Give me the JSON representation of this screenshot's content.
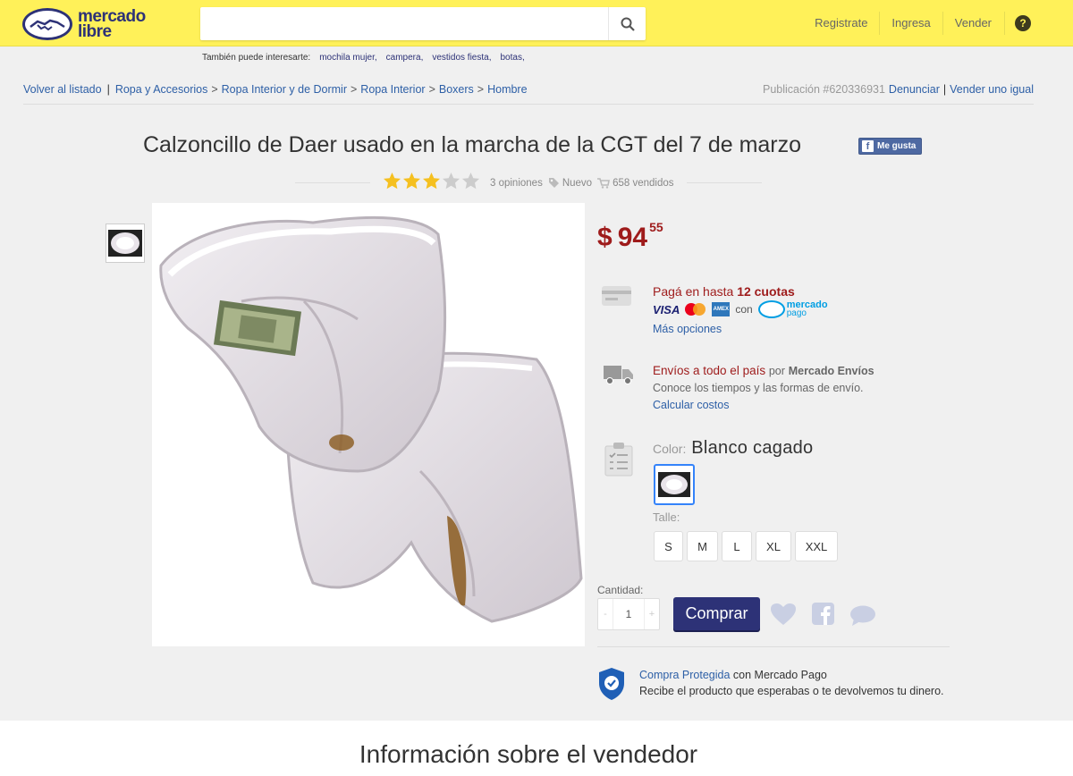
{
  "header": {
    "logo_line1": "mercado",
    "logo_line2": "libre",
    "search_placeholder": "",
    "nav": [
      "Registrate",
      "Ingresa",
      "Vender"
    ],
    "help": "?"
  },
  "suggestions": {
    "label": "También puede interesarte:",
    "items": [
      "mochila mujer,",
      "campera,",
      "vestidos fiesta,",
      "botas,"
    ]
  },
  "breadcrumb": {
    "back": "Volver al listado",
    "path": [
      "Ropa y Accesorios",
      "Ropa Interior y de Dormir",
      "Ropa Interior",
      "Boxers",
      "Hombre"
    ],
    "publication": "Publicación #620336931",
    "report": "Denunciar",
    "sell_same": "Vender uno igual"
  },
  "product": {
    "title": "Calzoncillo de Daer usado en la marcha de la CGT del 7 de marzo",
    "fb_like": "Me gusta",
    "rating": 3,
    "rating_max": 5,
    "opinions": "3 opiniones",
    "condition": "Nuevo",
    "sold": "658 vendidos"
  },
  "price": {
    "currency": "$",
    "integer": "94",
    "cents": "55"
  },
  "payment": {
    "text": "Pagá en hasta",
    "bold": "12 cuotas",
    "visa": "VISA",
    "amex": "AMEX",
    "con": "con",
    "mp_line1": "mercado",
    "mp_line2": "pago",
    "more": "Más opciones"
  },
  "shipping": {
    "text": "Envíos a todo el país",
    "por": "por",
    "provider": "Mercado Envíos",
    "sub": "Conoce los tiempos y las formas de envío.",
    "calc": "Calcular costos"
  },
  "variations": {
    "color_label": "Color:",
    "color_value": "Blanco cagado",
    "size_label": "Talle:",
    "sizes": [
      "S",
      "M",
      "L",
      "XL",
      "XXL"
    ]
  },
  "purchase": {
    "qty_label": "Cantidad:",
    "minus": "-",
    "qty": "1",
    "plus": "+",
    "buy": "Comprar"
  },
  "protection": {
    "link": "Compra Protegida",
    "rest": " con Mercado Pago",
    "sub": "Recibe el producto que esperabas o te devolvemos tu dinero."
  },
  "seller": {
    "title": "Información sobre el vendedor"
  },
  "colors": {
    "header_bg": "#fff159",
    "brand_blue": "#2d3277",
    "price_red": "#9e1b1b",
    "link_blue": "#2d5fa6",
    "star_gold": "#f5c020",
    "star_grey": "#ccc"
  }
}
